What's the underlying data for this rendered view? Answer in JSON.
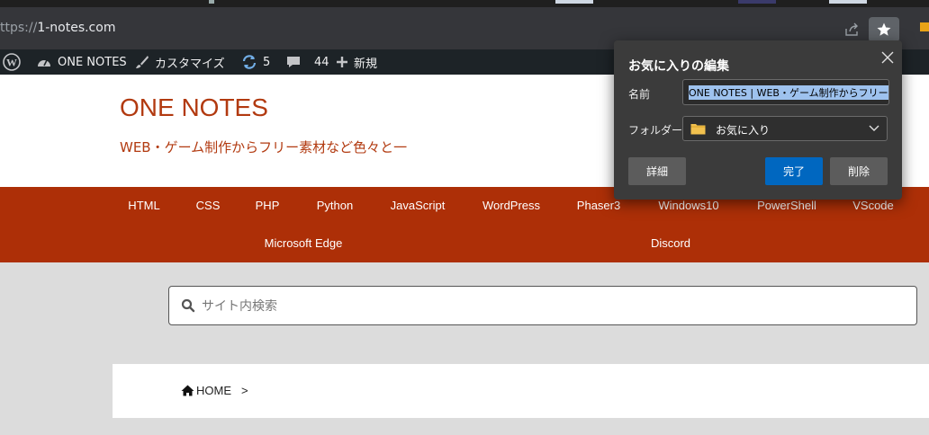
{
  "browser": {
    "url_prefix": "ttps://",
    "url_host": "1-notes.com"
  },
  "admin_bar": {
    "site_name": "ONE NOTES",
    "customize": "カスタマイズ",
    "updates_count": "5",
    "comments_count": "44",
    "new_label": "新規"
  },
  "site": {
    "title": "ONE NOTES",
    "description": "WEB・ゲーム制作からフリー素材など色々と一"
  },
  "nav": {
    "row1": [
      "HTML",
      "CSS",
      "PHP",
      "Python",
      "JavaScript",
      "WordPress",
      "Phaser3",
      "Windows10",
      "PowerShell",
      "VScode"
    ],
    "row2": [
      "Microsoft Edge",
      "Discord"
    ]
  },
  "search": {
    "placeholder": "サイト内検索"
  },
  "breadcrumb": {
    "home": "HOME",
    "separator": ">"
  },
  "favorites_popup": {
    "title": "お気に入りの編集",
    "name_label": "名前",
    "name_value": "ONE NOTES | WEB・ゲーム制作からフリー素材",
    "folder_label": "フォルダー",
    "folder_value": "お気に入り",
    "details_button": "詳細",
    "done_button": "完了",
    "delete_button": "削除"
  },
  "colors": {
    "brand": "#ad2f07",
    "title": "#b23a10",
    "primary_button": "#0067c0"
  }
}
